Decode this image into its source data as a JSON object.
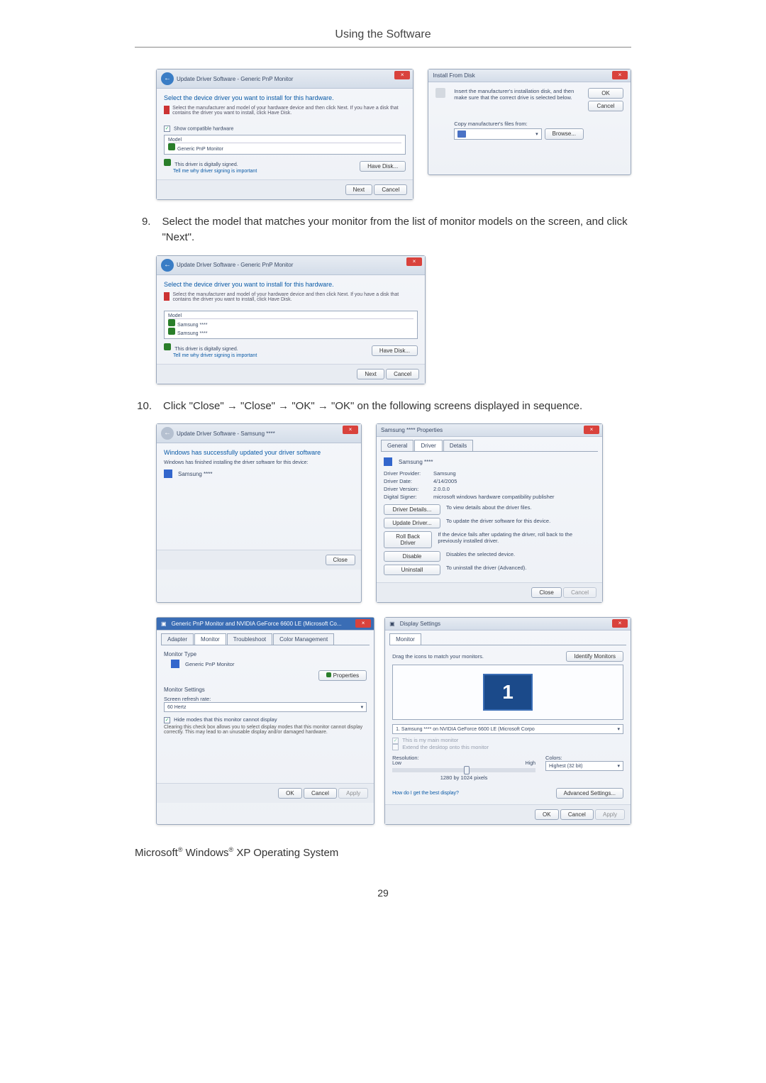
{
  "title": "Using the Software",
  "page_number": "29",
  "step9": {
    "num": "9.",
    "text": "Select the model that matches your monitor from the list of monitor models on the screen, and click \"Next\"."
  },
  "step10": {
    "num": "10.",
    "text": "Click \"Close\" → \"Close\" → \"OK\" → \"OK\" on the following screens displayed in sequence."
  },
  "footer": {
    "p1": "Microsoft",
    "reg": "®",
    "p2": " Windows",
    "p3": " XP Operating System"
  },
  "win_update1": {
    "title": "Update Driver Software - Generic PnP Monitor",
    "heading": "Select the device driver you want to install for this hardware.",
    "sub": "Select the manufacturer and model of your hardware device and then click Next. If you have a disk that contains the driver you want to install, click Have Disk.",
    "show_compat": "Show compatible hardware",
    "model_hdr": "Model",
    "model_item": "Generic PnP Monitor",
    "signed": "This driver is digitally signed.",
    "tell_me": "Tell me why driver signing is important",
    "have_disk": "Have Disk...",
    "next": "Next",
    "cancel": "Cancel"
  },
  "win_install_disk": {
    "title": "Install From Disk",
    "msg": "Insert the manufacturer's installation disk, and then make sure that the correct drive is selected below.",
    "ok": "OK",
    "cancel": "Cancel",
    "copy": "Copy manufacturer's files from:",
    "browse": "Browse..."
  },
  "win_update2": {
    "title": "Update Driver Software - Generic PnP Monitor",
    "heading": "Select the device driver you want to install for this hardware.",
    "sub": "Select the manufacturer and model of your hardware device and then click Next. If you have a disk that contains the driver you want to install, click Have Disk.",
    "model_hdr": "Model",
    "item1": "Samsung ****",
    "item2": "Samsung ****",
    "signed": "This driver is digitally signed.",
    "tell_me": "Tell me why driver signing is important",
    "have_disk": "Have Disk...",
    "next": "Next",
    "cancel": "Cancel"
  },
  "win_success": {
    "title": "Update Driver Software - Samsung ****",
    "heading": "Windows has successfully updated your driver software",
    "sub": "Windows has finished installing the driver software for this device:",
    "device": "Samsung ****",
    "close": "Close"
  },
  "win_props": {
    "title": "Samsung **** Properties",
    "tab_general": "General",
    "tab_driver": "Driver",
    "tab_details": "Details",
    "device": "Samsung ****",
    "provider_lbl": "Driver Provider:",
    "provider": "Samsung",
    "date_lbl": "Driver Date:",
    "date": "4/14/2005",
    "version_lbl": "Driver Version:",
    "version": "2.0.0.0",
    "signer_lbl": "Digital Signer:",
    "signer": "microsoft windows hardware compatibility publisher",
    "btn_details": "Driver Details...",
    "txt_details": "To view details about the driver files.",
    "btn_update": "Update Driver...",
    "txt_update": "To update the driver software for this device.",
    "btn_rollback": "Roll Back Driver",
    "txt_rollback": "If the device fails after updating the driver, roll back to the previously installed driver.",
    "btn_disable": "Disable",
    "txt_disable": "Disables the selected device.",
    "btn_uninstall": "Uninstall",
    "txt_uninstall": "To uninstall the driver (Advanced).",
    "close": "Close",
    "cancel": "Cancel"
  },
  "win_generic": {
    "title": "Generic PnP Monitor and NVIDIA GeForce 6600 LE (Microsoft Co...",
    "tab_adapter": "Adapter",
    "tab_monitor": "Monitor",
    "tab_troubleshoot": "Troubleshoot",
    "tab_color": "Color Management",
    "mon_type": "Monitor Type",
    "mon_name": "Generic PnP Monitor",
    "properties": "Properties",
    "mon_settings": "Monitor Settings",
    "refresh_lbl": "Screen refresh rate:",
    "refresh_val": "60 Hertz",
    "hide_modes": "Hide modes that this monitor cannot display",
    "hide_desc": "Clearing this check box allows you to select display modes that this monitor cannot display correctly. This may lead to an unusable display and/or damaged hardware.",
    "ok": "OK",
    "cancel": "Cancel",
    "apply": "Apply"
  },
  "win_display": {
    "title": "Display Settings",
    "tab_monitor": "Monitor",
    "drag": "Drag the icons to match your monitors.",
    "identify": "Identify Monitors",
    "mon1": "1",
    "device": "1. Samsung **** on NVIDIA GeForce 6600 LE (Microsoft Corpo",
    "main": "This is my main monitor",
    "extend": "Extend the desktop onto this monitor",
    "resolution": "Resolution:",
    "low": "Low",
    "high": "High",
    "res_val": "1280 by 1024 pixels",
    "colors": "Colors:",
    "colors_val": "Highest (32 bit)",
    "best": "How do I get the best display?",
    "advanced": "Advanced Settings...",
    "ok": "OK",
    "cancel": "Cancel",
    "apply": "Apply"
  }
}
